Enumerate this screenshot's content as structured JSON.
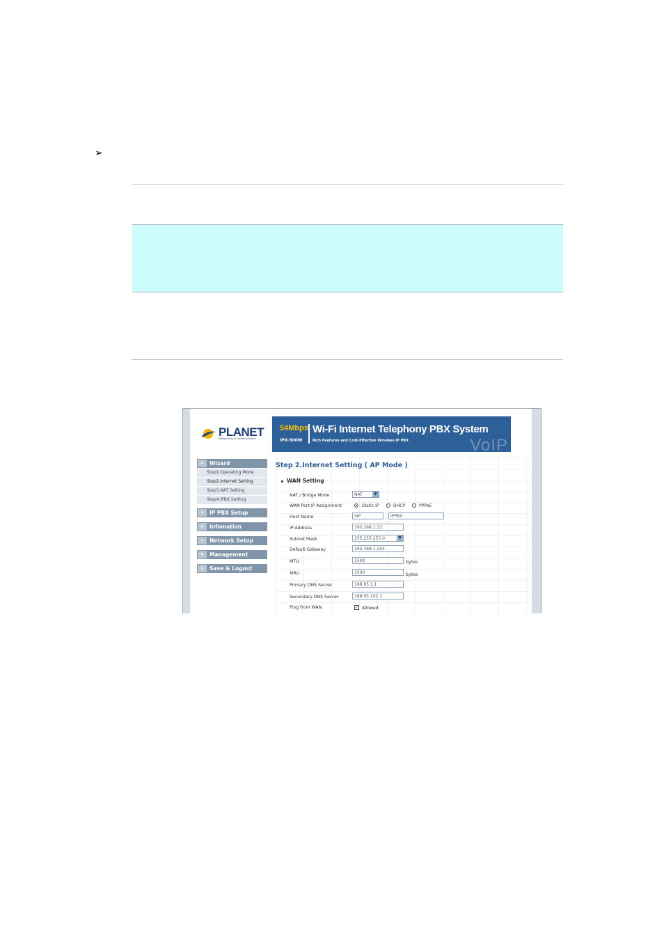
{
  "doc": {
    "bullet": "➢"
  },
  "logo": {
    "name": "PLANET",
    "tagline": "Networking & Communication"
  },
  "banner": {
    "speed": "54Mbps",
    "model": "IPX-300W",
    "title": "Wi-Fi Internet Telephony PBX System",
    "subtitle": "Rich Features and Cost-Effective Wireless IP PBX",
    "watermark": "VoIP"
  },
  "sidebar": {
    "wizard": {
      "label": "Wizard",
      "items": [
        "Step1.Operating Mode",
        "Step2.Internet Setting",
        "Step3.NAT Setting",
        "Step4.IPBX Setting"
      ]
    },
    "menus": [
      "IP PBX Setup",
      "Infomation",
      "Network Setup",
      "Management",
      "Save & Logout"
    ],
    "arrow": "»"
  },
  "content": {
    "title": "Step 2.Internet Setting ( AP Mode )",
    "section": "WAN Setting",
    "fields": {
      "nat_bridge": {
        "label": "NAT / Bridge Mode",
        "value": "NAT"
      },
      "wan_port": {
        "label": "WAN Port IP Assignment",
        "options": [
          "Static IP",
          "DHCP",
          "PPPoE"
        ],
        "selected": "Static IP"
      },
      "host_name": {
        "label": "Host Name",
        "value1": "SIP",
        "sep": ".",
        "value2": "IPPBX"
      },
      "ip_address": {
        "label": "IP Address",
        "value": "192.168.1.31"
      },
      "subnet_mask": {
        "label": "Subnet Mask",
        "value": "255.255.255.0"
      },
      "default_gateway": {
        "label": "Default Gateway",
        "value": "192.168.1.254"
      },
      "mtu": {
        "label": "MTU",
        "value": "1500",
        "unit": "bytes"
      },
      "mru": {
        "label": "MRU",
        "value": "1500",
        "unit": "bytes"
      },
      "primary_dns": {
        "label": "Primary DNS Server",
        "value": "168.95.1.1"
      },
      "secondary_dns": {
        "label": "Secondary DNS Server",
        "value": "168.95.192.1"
      },
      "ping_wan": {
        "label": "Ping from WAN",
        "option": "Allowed",
        "checked": true
      }
    }
  },
  "colors": {
    "banner": "#2d5f98",
    "nav": "#8095aa",
    "title": "#2f5c93",
    "band": "#ccfcfc"
  }
}
